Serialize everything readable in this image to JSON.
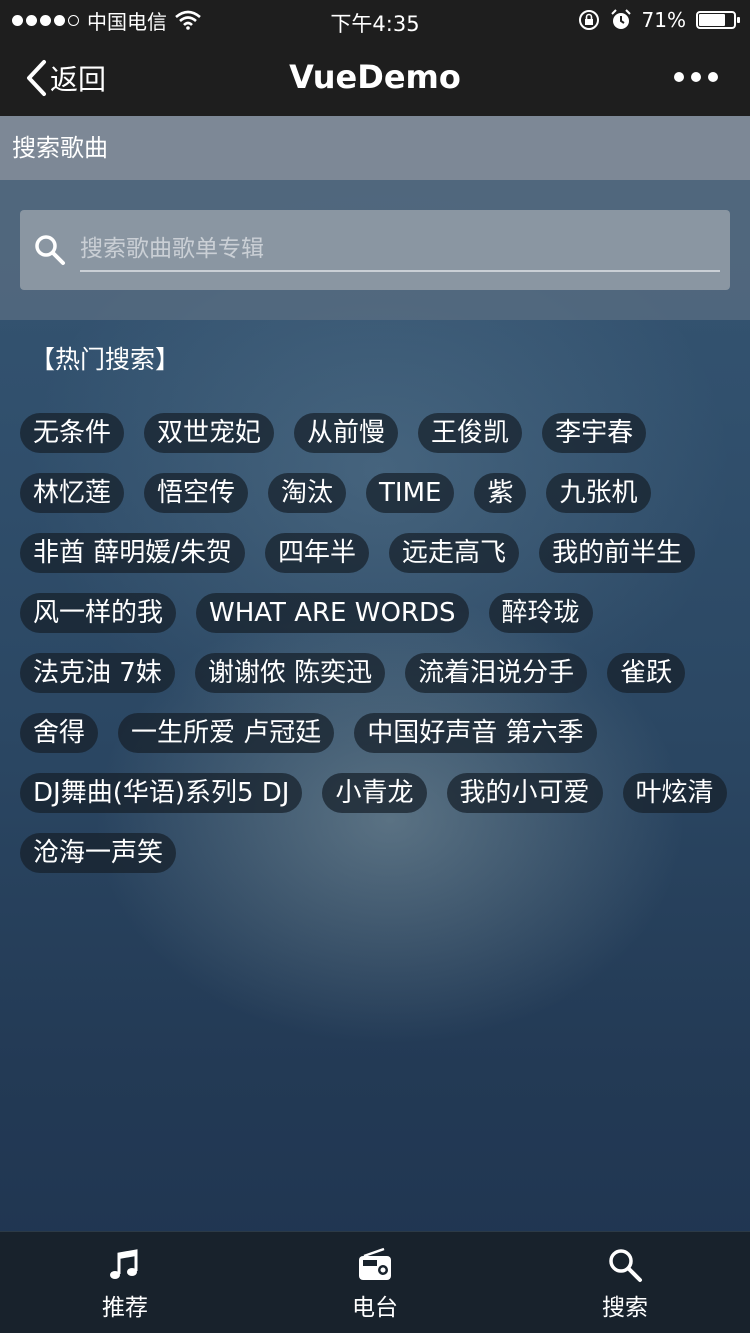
{
  "status_bar": {
    "carrier": "中国电信",
    "time": "下午4:35",
    "battery_percent": "71%",
    "battery_level": 0.71
  },
  "nav": {
    "back_label": "返回",
    "title": "VueDemo"
  },
  "section": {
    "title": "搜索歌曲"
  },
  "search": {
    "placeholder": "搜索歌曲歌单专辑",
    "value": ""
  },
  "hot": {
    "title": "【热门搜索】",
    "tags": [
      "无条件",
      "双世宠妃",
      "从前慢",
      "王俊凯",
      "李宇春",
      "林忆莲",
      "悟空传",
      "淘汰",
      "TIME",
      "紫",
      "九张机",
      "非酋 薛明媛/朱贺",
      "四年半",
      "远走高飞",
      "我的前半生",
      "风一样的我",
      "WHAT ARE WORDS",
      "醉玲珑",
      "法克油 7妹",
      "谢谢侬 陈奕迅",
      "流着泪说分手",
      "雀跃",
      "舍得",
      "一生所爱 卢冠廷",
      "中国好声音 第六季",
      "DJ舞曲(华语)系列5 DJ",
      "小青龙",
      "我的小可爱",
      "叶炫清",
      "沧海一声笑"
    ]
  },
  "tabs": [
    {
      "label": "推荐",
      "icon": "music-note-icon"
    },
    {
      "label": "电台",
      "icon": "radio-icon"
    },
    {
      "label": "搜索",
      "icon": "search-icon"
    }
  ]
}
